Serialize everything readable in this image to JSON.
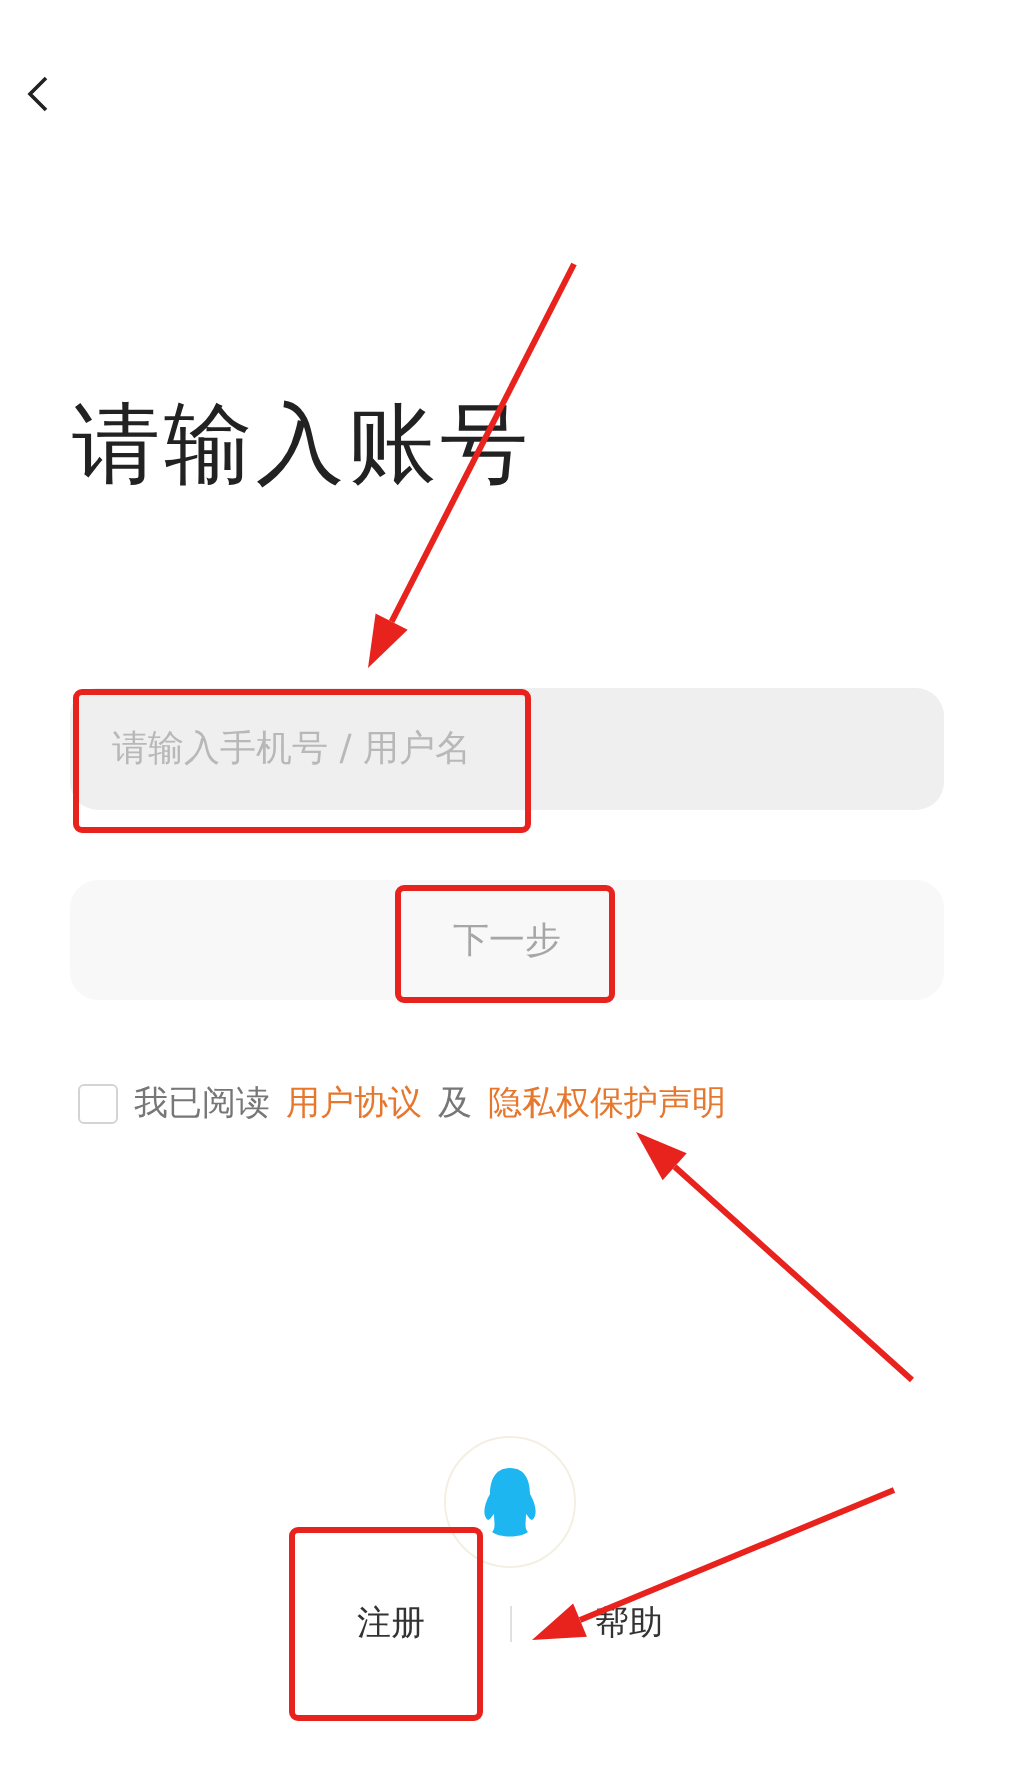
{
  "title": "请输入账号",
  "account_field": {
    "placeholder": "请输入手机号 / 用户名"
  },
  "next_button": {
    "label": "下一步",
    "disabled": true
  },
  "agreement": {
    "checked": false,
    "prefix": "我已阅读",
    "links": [
      {
        "label": "用户协议"
      },
      {
        "label": "隐私权保护声明"
      }
    ],
    "joiner": "及"
  },
  "footer": {
    "links": [
      {
        "label": "注册"
      },
      {
        "label": "帮助"
      }
    ]
  }
}
